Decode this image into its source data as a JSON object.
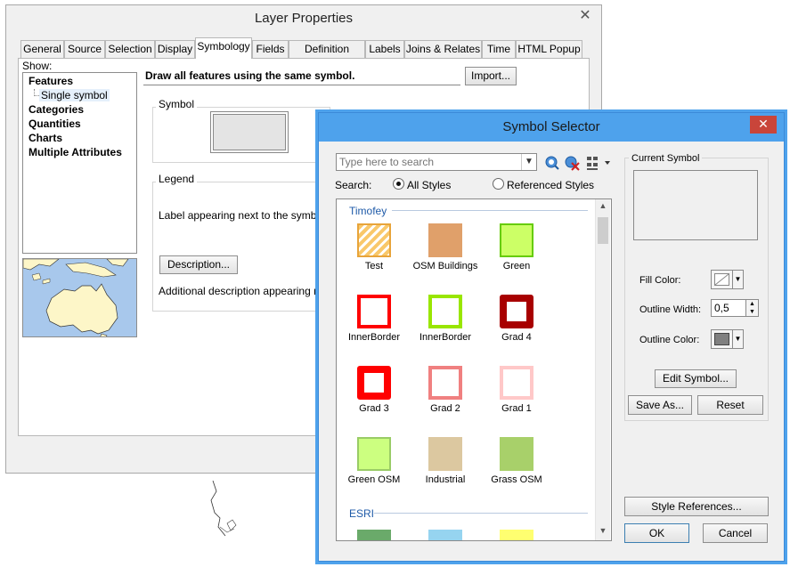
{
  "layer_properties": {
    "title": "Layer Properties",
    "tabs": [
      "General",
      "Source",
      "Selection",
      "Display",
      "Symbology",
      "Fields",
      "Definition Query",
      "Labels",
      "Joins & Relates",
      "Time",
      "HTML Popup"
    ],
    "active_tab": "Symbology",
    "show_label": "Show:",
    "tree": {
      "features": "Features",
      "single_symbol": "Single symbol",
      "categories": "Categories",
      "quantities": "Quantities",
      "charts": "Charts",
      "multiple_attributes": "Multiple Attributes"
    },
    "description_heading": "Draw all features using the same symbol.",
    "import_label": "Import...",
    "symbol_group_label": "Symbol",
    "legend_group_label": "Legend",
    "legend_text": "Label appearing next to the symbol in",
    "description_button": "Description...",
    "additional_description": "Additional description appearing next"
  },
  "symbol_selector": {
    "title": "Symbol Selector",
    "close_icon": "close-icon",
    "search": {
      "placeholder": "Type here to search",
      "label": "Search:",
      "all_styles": "All Styles",
      "referenced_styles": "Referenced Styles",
      "selected": "All Styles"
    },
    "sections": [
      {
        "name": "Timofey",
        "symbols": [
          {
            "label": "Test",
            "fill": "#f9c86a",
            "outline": "#e8a43a",
            "pattern": "hatch"
          },
          {
            "label": "OSM Buildings",
            "fill": "#e0a06a",
            "outline": "#e0a06a",
            "pattern": "solid"
          },
          {
            "label": "Green",
            "fill": "#ccff66",
            "outline": "#66cc00",
            "pattern": "solid"
          },
          {
            "label": "InnerBorder",
            "fill": "#ffffff",
            "outline": "#ff0000",
            "pattern": "hollow"
          },
          {
            "label": "InnerBorder",
            "fill": "#ffffff",
            "outline": "#99e600",
            "pattern": "hollow"
          },
          {
            "label": "Grad 4",
            "fill": "#ffffff",
            "outline": "#a80000",
            "pattern": "thick"
          },
          {
            "label": "Grad 3",
            "fill": "#ffffff",
            "outline": "#ff0000",
            "pattern": "thick"
          },
          {
            "label": "Grad 2",
            "fill": "#ffffff",
            "outline": "#f08080",
            "pattern": "hollow"
          },
          {
            "label": "Grad 1",
            "fill": "#ffffff",
            "outline": "#ffc8c8",
            "pattern": "hollow"
          },
          {
            "label": "Green OSM",
            "fill": "#ccff80",
            "outline": "#99cc66",
            "pattern": "solid"
          },
          {
            "label": "Industrial",
            "fill": "#dcc8a0",
            "outline": "#dcc8a0",
            "pattern": "solid"
          },
          {
            "label": "Grass OSM",
            "fill": "#a8d06a",
            "outline": "#a8d06a",
            "pattern": "solid"
          }
        ]
      },
      {
        "name": "ESRI",
        "symbols": [
          {
            "label": "",
            "fill": "#6aaa6a",
            "outline": "#6aaa6a",
            "pattern": "solid"
          },
          {
            "label": "",
            "fill": "#96d4f0",
            "outline": "#96d4f0",
            "pattern": "solid"
          },
          {
            "label": "",
            "fill": "#ffff70",
            "outline": "#ffff70",
            "pattern": "solid"
          }
        ]
      }
    ],
    "current_symbol_label": "Current Symbol",
    "fill_color_label": "Fill Color:",
    "outline_width_label": "Outline Width:",
    "outline_width_value": "0,5",
    "outline_color_label": "Outline Color:",
    "outline_color": "#808080",
    "edit_symbol_label": "Edit Symbol...",
    "save_as_label": "Save As...",
    "reset_label": "Reset",
    "style_references_label": "Style References...",
    "ok_label": "OK",
    "cancel_label": "Cancel"
  }
}
